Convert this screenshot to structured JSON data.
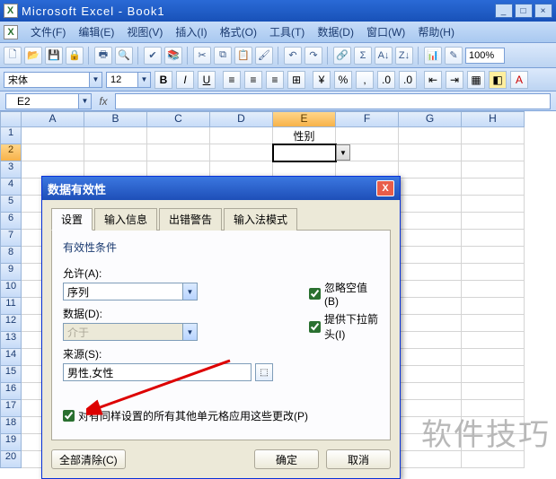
{
  "window": {
    "title": "Microsoft Excel - Book1"
  },
  "menus": {
    "file": "文件(F)",
    "edit": "编辑(E)",
    "view": "视图(V)",
    "insert": "插入(I)",
    "format": "格式(O)",
    "tools": "工具(T)",
    "data": "数据(D)",
    "window": "窗口(W)",
    "help": "帮助(H)"
  },
  "toolbar": {
    "zoom": "100%"
  },
  "format": {
    "font": "宋体",
    "size": "12"
  },
  "namebox": {
    "ref": "E2"
  },
  "columns": [
    "A",
    "B",
    "C",
    "D",
    "E",
    "F",
    "G",
    "H"
  ],
  "rows_count": 20,
  "active": {
    "col": "E",
    "row": 2
  },
  "cells": {
    "E1": "性别"
  },
  "dialog": {
    "title": "数据有效性",
    "tabs": {
      "settings": "设置",
      "input": "输入信息",
      "error": "出错警告",
      "ime": "输入法模式"
    },
    "fieldset": "有效性条件",
    "allow_label": "允许(A):",
    "allow_value": "序列",
    "data_label": "数据(D):",
    "data_value": "介于",
    "source_label": "来源(S):",
    "source_value": "男性,女性",
    "cb_ignore": "忽略空值(B)",
    "cb_dropdown": "提供下拉箭头(I)",
    "cb_apply": "对有同样设置的所有其他单元格应用这些更改(P)",
    "clear": "全部清除(C)",
    "ok": "确定",
    "cancel": "取消"
  },
  "watermark": "软件技巧"
}
